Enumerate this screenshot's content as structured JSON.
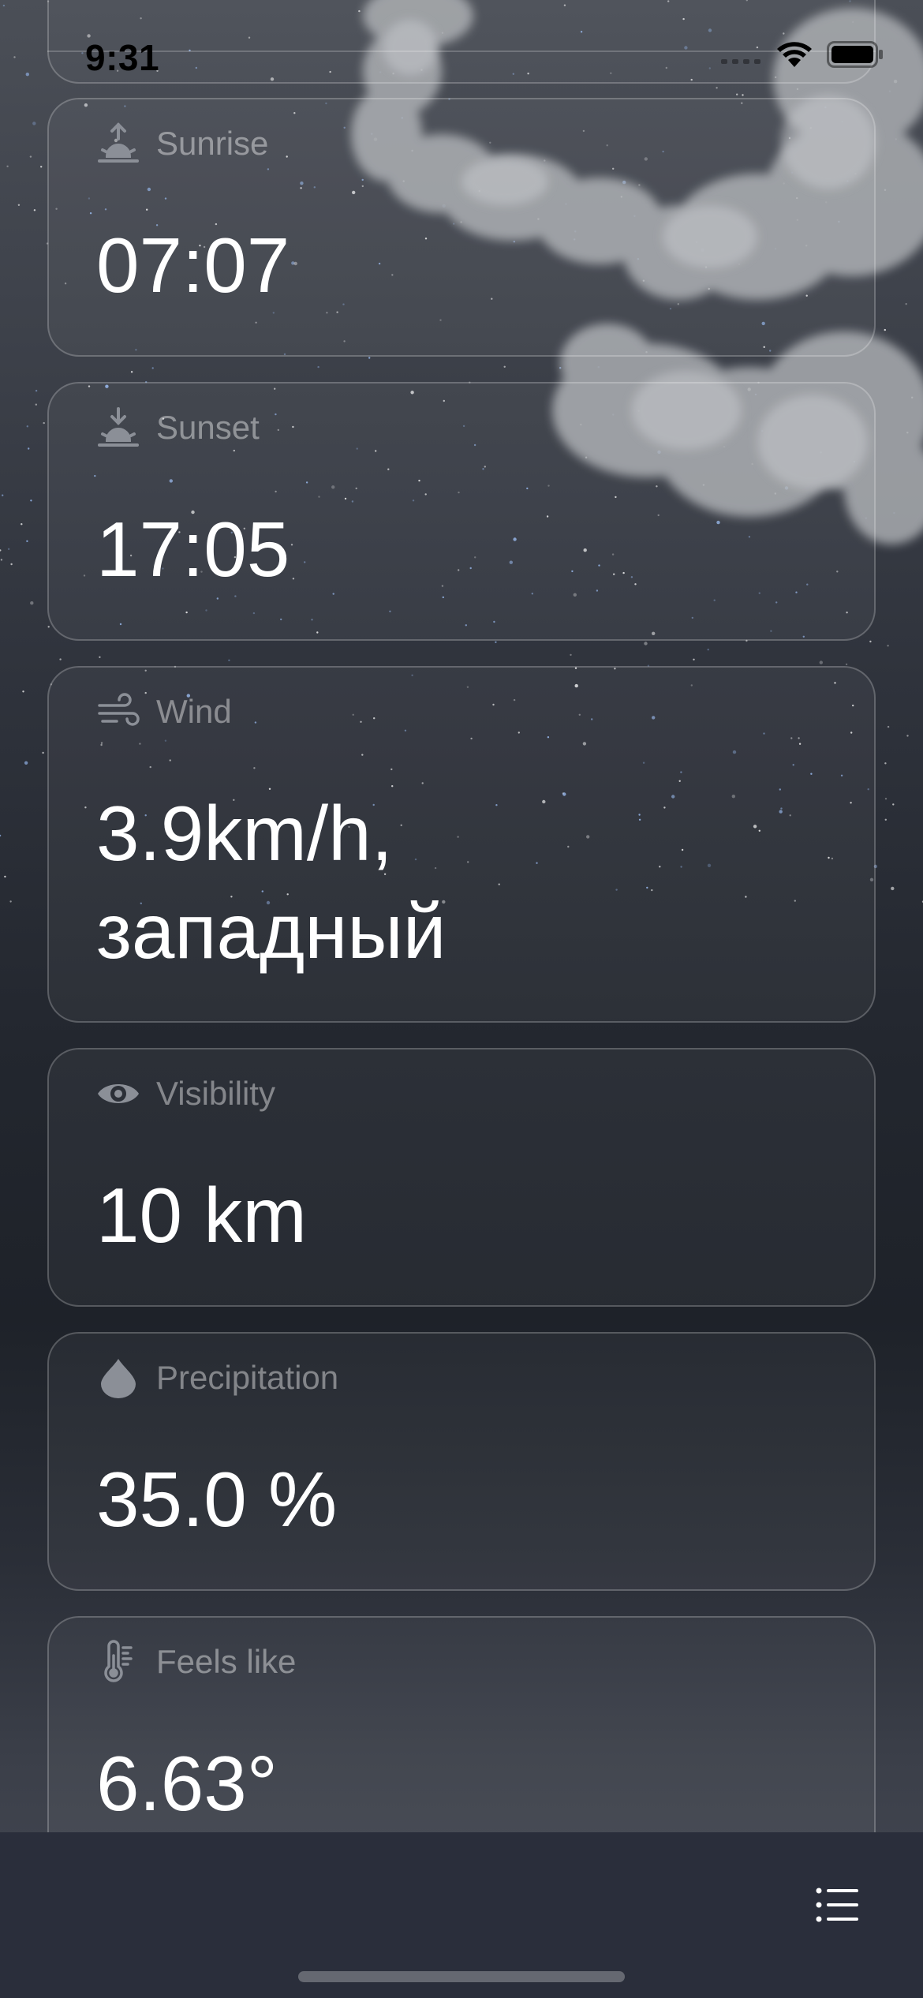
{
  "status_bar": {
    "time": "9:31",
    "icons": [
      "cellular-signal-icon",
      "wifi-icon",
      "battery-icon"
    ]
  },
  "cards": {
    "sunrise": {
      "label": "Sunrise",
      "value": "07:07",
      "icon": "sunrise-icon"
    },
    "sunset": {
      "label": "Sunset",
      "value": "17:05",
      "icon": "sunset-icon"
    },
    "wind": {
      "label": "Wind",
      "value": "3.9km/h,\nзападный",
      "icon": "wind-icon"
    },
    "visibility": {
      "label": "Visibility",
      "value": "10 km",
      "icon": "eye-icon"
    },
    "precipitation": {
      "label": "Precipitation",
      "value": "35.0 %",
      "icon": "drop-icon"
    },
    "feels_like": {
      "label": "Feels like",
      "value": "6.63°",
      "icon": "thermometer-icon"
    }
  },
  "toolbar": {
    "list_icon": "list-icon"
  },
  "colors": {
    "label": "#8b8f97",
    "value": "#ffffff",
    "toolbar_bg": "#2a2e3b"
  }
}
